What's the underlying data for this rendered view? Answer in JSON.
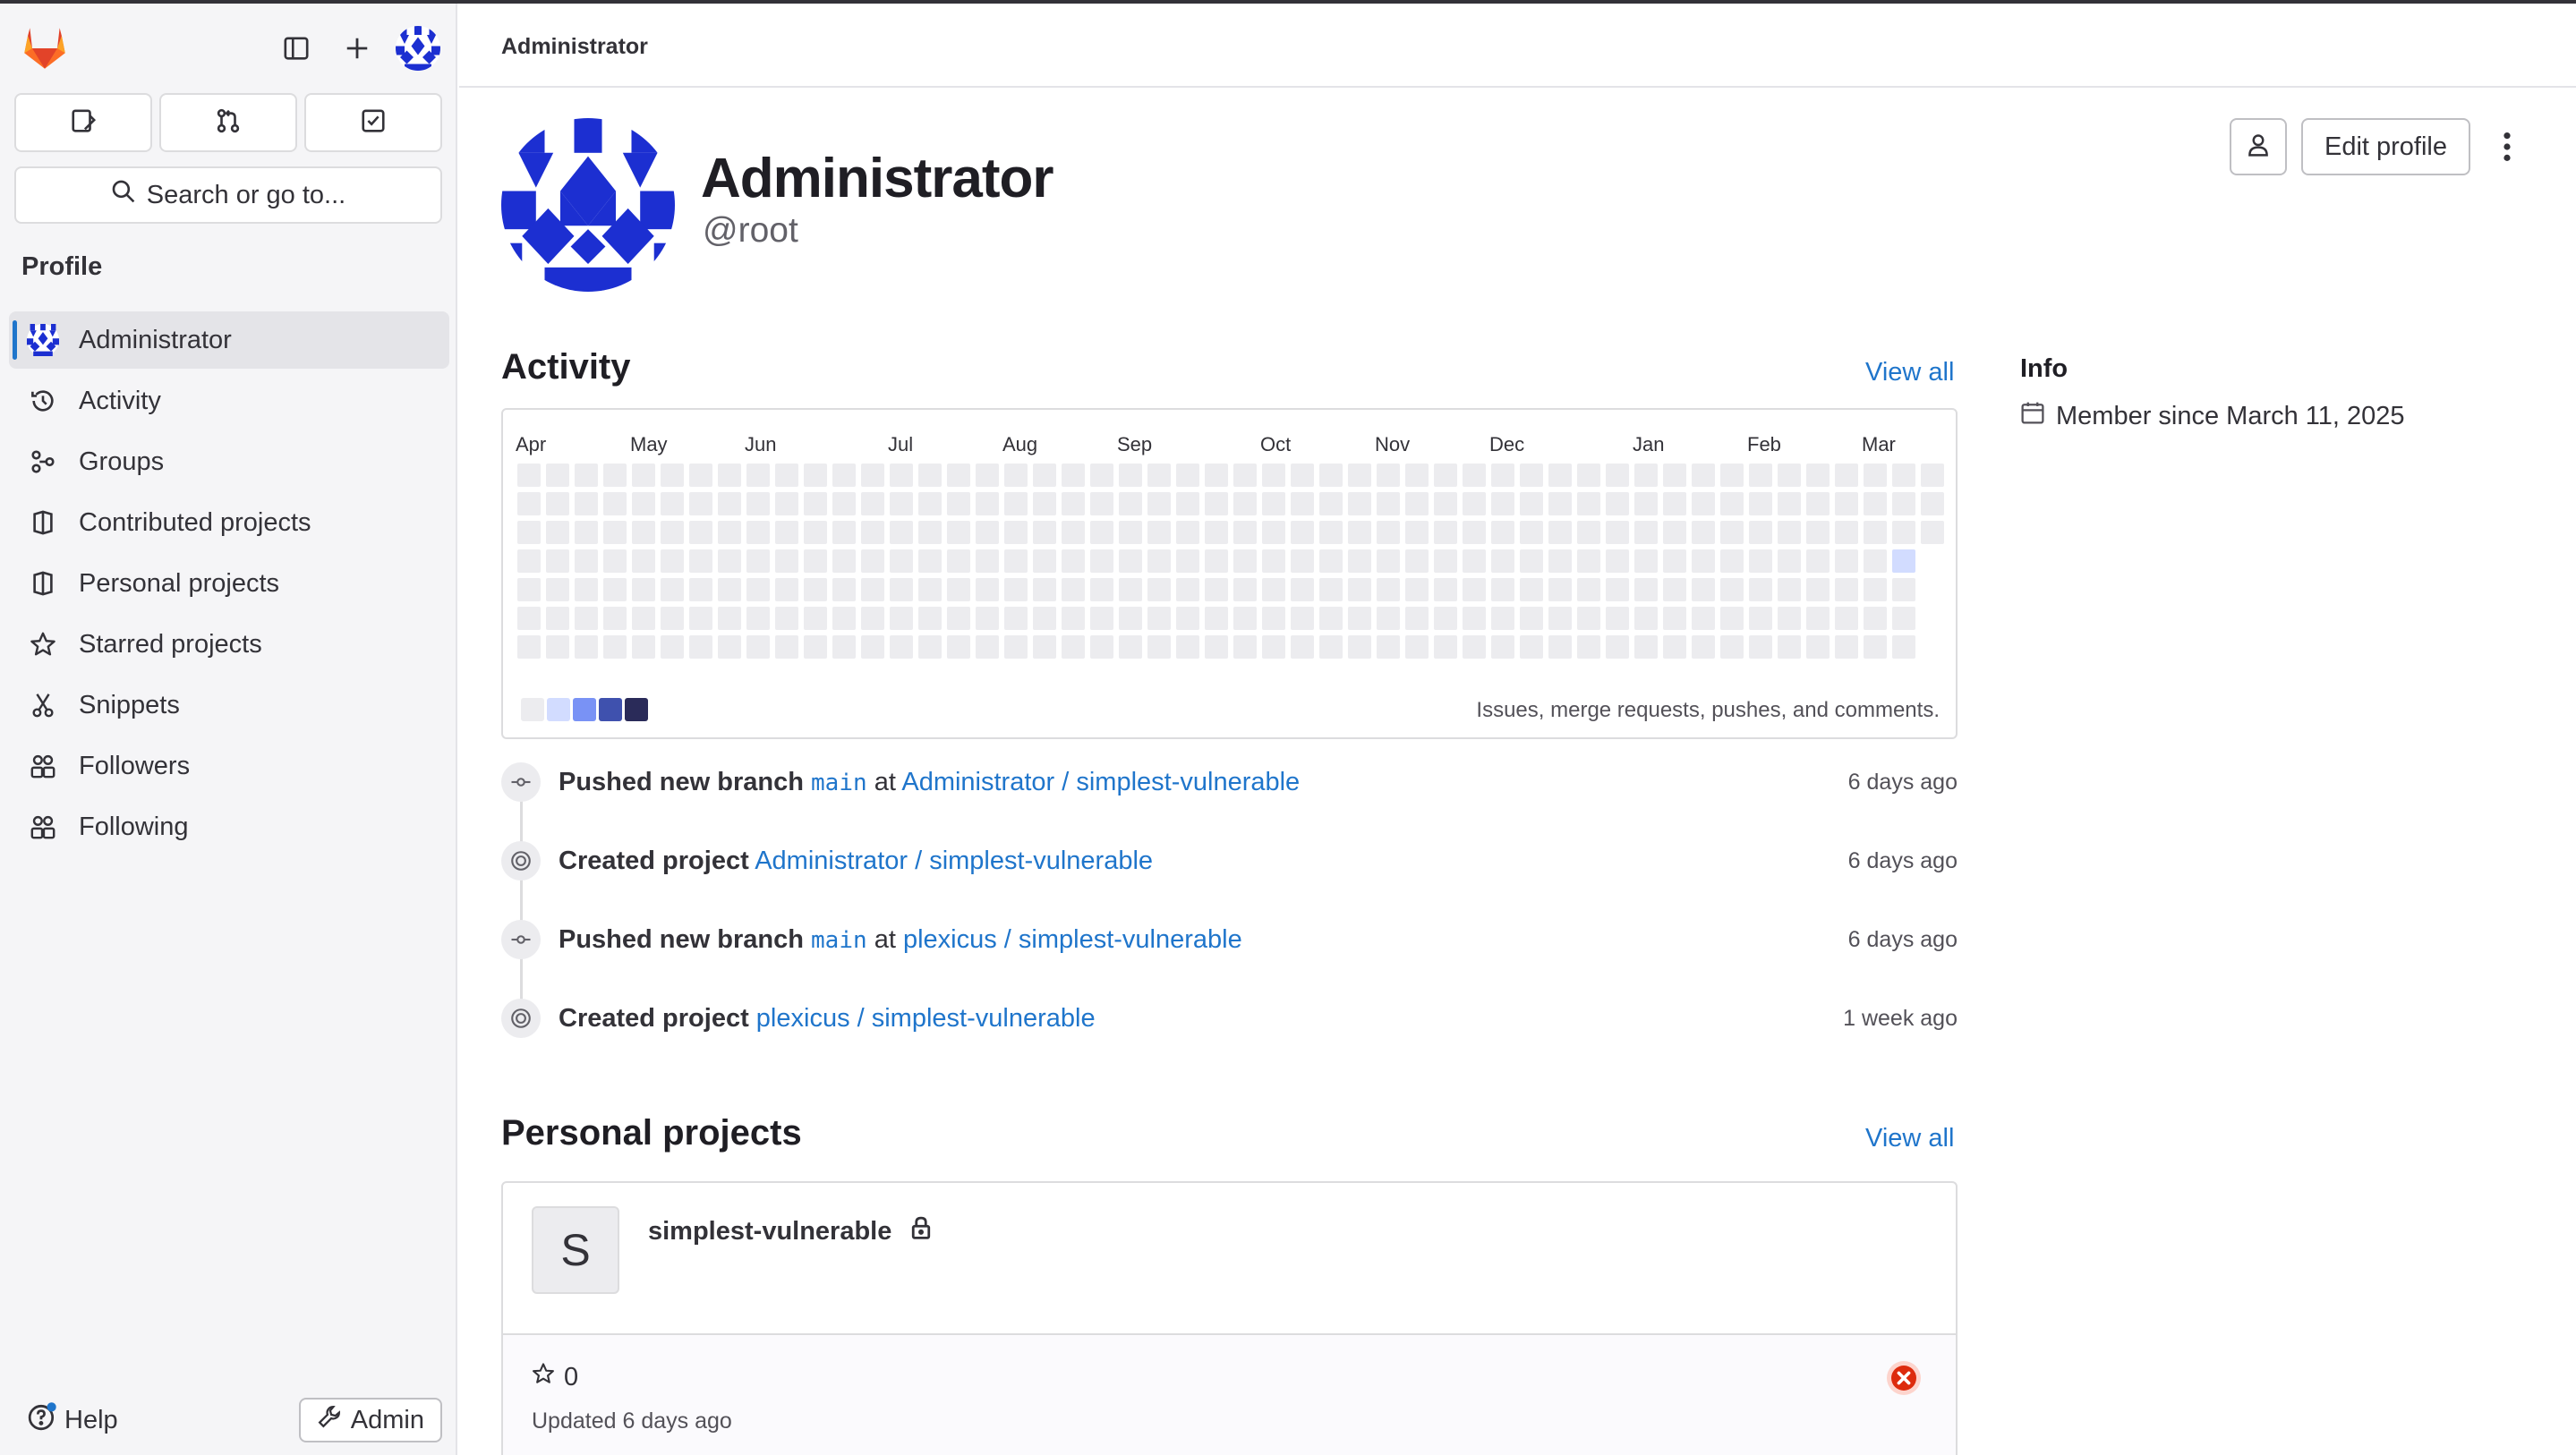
{
  "sidebar": {
    "section_title": "Profile",
    "search_placeholder": "Search or go to...",
    "nav": [
      {
        "label": "Administrator"
      },
      {
        "label": "Activity"
      },
      {
        "label": "Groups"
      },
      {
        "label": "Contributed projects"
      },
      {
        "label": "Personal projects"
      },
      {
        "label": "Starred projects"
      },
      {
        "label": "Snippets"
      },
      {
        "label": "Followers"
      },
      {
        "label": "Following"
      }
    ],
    "help_label": "Help",
    "admin_label": "Admin"
  },
  "breadcrumb": "Administrator",
  "profile": {
    "name": "Administrator",
    "handle": "@root",
    "edit_label": "Edit profile"
  },
  "activity": {
    "title": "Activity",
    "view_all": "View all",
    "months": [
      "Apr",
      "May",
      "Jun",
      "Jul",
      "Aug",
      "Sep",
      "Oct",
      "Nov",
      "Dec",
      "Jan",
      "Feb",
      "Mar"
    ],
    "caption": "Issues, merge requests, pushes, and comments.",
    "legend_colors": [
      "#ececef",
      "#d2dcff",
      "#7992f5",
      "#3f51ae",
      "#2a2b59"
    ],
    "events": [
      {
        "action": "Pushed new branch",
        "branch": "main",
        "at": "at",
        "project": "Administrator / simplest-vulnerable",
        "time": "6 days ago",
        "icon": "commit-icon"
      },
      {
        "action": "Created project",
        "project": "Administrator / simplest-vulnerable",
        "time": "6 days ago",
        "icon": "status-icon"
      },
      {
        "action": "Pushed new branch",
        "branch": "main",
        "at": "at",
        "project": "plexicus / simplest-vulnerable",
        "time": "6 days ago",
        "icon": "commit-icon"
      },
      {
        "action": "Created project",
        "project": "plexicus / simplest-vulnerable",
        "time": "1 week ago",
        "icon": "status-icon"
      }
    ]
  },
  "personal_projects": {
    "title": "Personal projects",
    "view_all": "View all",
    "project": {
      "initial": "S",
      "name": "simplest-vulnerable",
      "stars": "0",
      "updated": "Updated 6 days ago",
      "visibility_icon": "lock-icon",
      "pipeline_status": "failed"
    }
  },
  "info": {
    "title": "Info",
    "member_since": "Member since March 11, 2025"
  }
}
